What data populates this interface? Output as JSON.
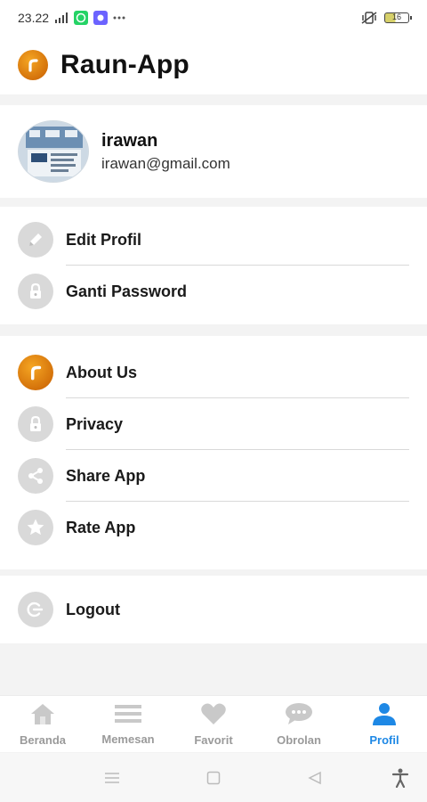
{
  "status_bar": {
    "time": "23.22",
    "battery": "16"
  },
  "header": {
    "title": "Raun-App"
  },
  "profile": {
    "name": "irawan",
    "email": "irawan@gmail.com"
  },
  "account_menu": [
    {
      "label": "Edit Profil",
      "icon": "pencil-icon"
    },
    {
      "label": "Ganti Password",
      "icon": "lock-icon"
    }
  ],
  "info_menu": [
    {
      "label": "About Us",
      "icon": "app-logo-icon"
    },
    {
      "label": "Privacy",
      "icon": "lock-icon"
    },
    {
      "label": "Share App",
      "icon": "share-icon"
    },
    {
      "label": "Rate App",
      "icon": "star-icon"
    }
  ],
  "logout_menu": [
    {
      "label": "Logout",
      "icon": "logout-icon"
    }
  ],
  "bottom_nav": [
    {
      "label": "Beranda",
      "icon": "home-icon"
    },
    {
      "label": "Memesan",
      "icon": "list-icon"
    },
    {
      "label": "Favorit",
      "icon": "heart-icon"
    },
    {
      "label": "Obrolan",
      "icon": "chat-icon"
    },
    {
      "label": "Profil",
      "icon": "person-icon",
      "active": true
    }
  ],
  "colors": {
    "accent": "#1e88e5",
    "brand": "#e07b00",
    "icon_bg": "#d9d9d9",
    "inactive": "#9a9a9a"
  }
}
